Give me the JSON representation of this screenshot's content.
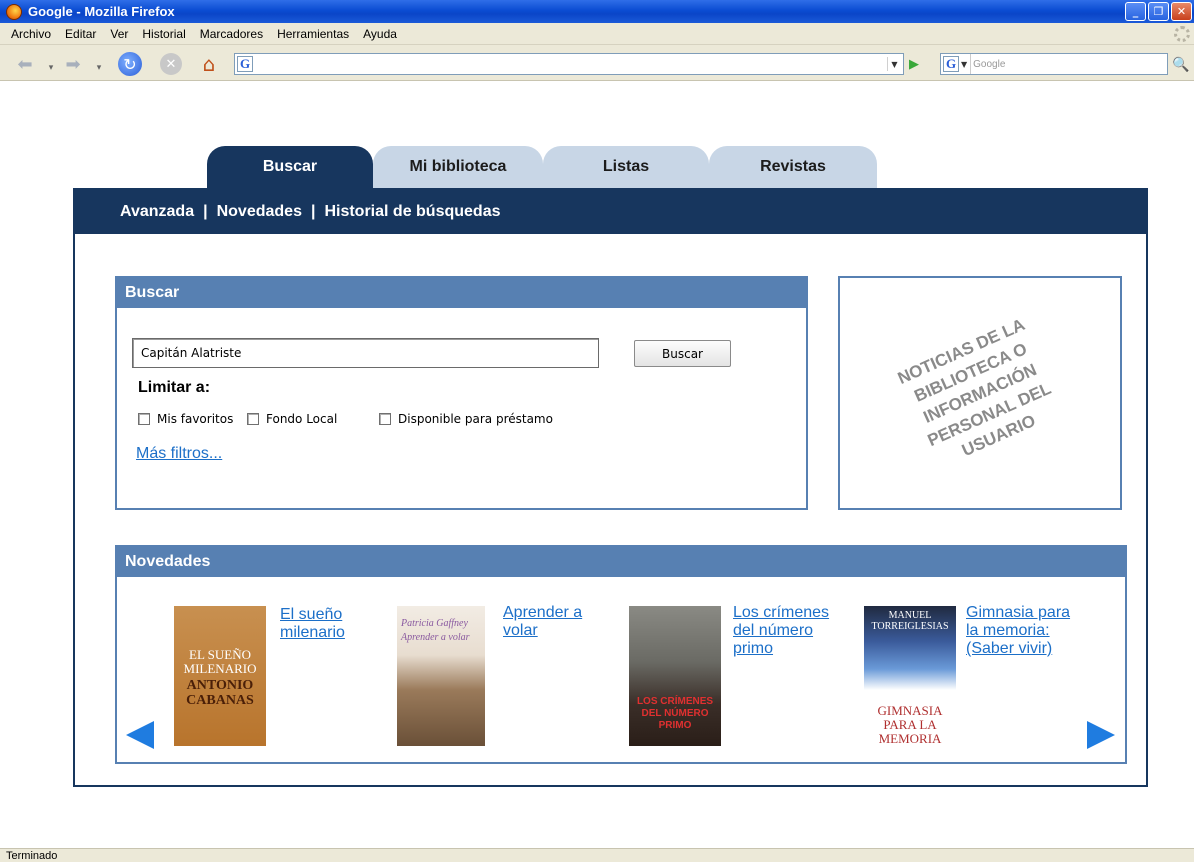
{
  "window": {
    "title": "Google - Mozilla Firefox"
  },
  "menu": [
    "Archivo",
    "Editar",
    "Ver",
    "Historial",
    "Marcadores",
    "Herramientas",
    "Ayuda"
  ],
  "toolbar": {
    "search_placeholder": "Google"
  },
  "tabs": [
    "Buscar",
    "Mi biblioteca",
    "Listas",
    "Revistas"
  ],
  "subnav": [
    "Avanzada",
    "Novedades",
    "Historial de búsquedas"
  ],
  "search_panel": {
    "title": "Buscar",
    "query": "Capitán Alatriste",
    "button": "Buscar",
    "limit_label": "Limitar a:",
    "filters": [
      "Mis favoritos",
      "Fondo Local",
      "Disponible para préstamo"
    ],
    "more_filters": "Más filtros..."
  },
  "news_box": {
    "text": "NOTICIAS DE LA BIBLIOTECA O INFORMACIÓN PERSONAL DEL USUARIO"
  },
  "novedades": {
    "title": "Novedades",
    "books": [
      {
        "title": "El sueño milenario",
        "cover_text": "EL SUEÑO MILENARIO",
        "cover_author": "ANTONIO CABANAS"
      },
      {
        "title": "Aprender a volar",
        "cover_text": "Patricia Gaffney",
        "cover_author": "Aprender a volar"
      },
      {
        "title": "Los crímenes del número primo",
        "cover_text": "LOS CRÍMENES DEL NÚMERO PRIMO"
      },
      {
        "title": "Gimnasia para la memoria: (Saber vivir)",
        "cover_text": "MANUEL TORREIGLESIAS",
        "cover_author": "GIMNASIA PARA LA MEMORIA"
      }
    ]
  },
  "status": "Terminado"
}
